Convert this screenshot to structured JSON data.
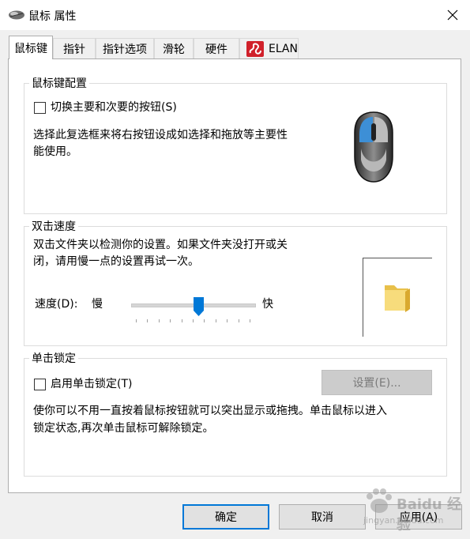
{
  "window": {
    "title": "鼠标 属性",
    "close_label": "✕"
  },
  "tabs": [
    "鼠标键",
    "指针",
    "指针选项",
    "滑轮",
    "硬件",
    "ELAN"
  ],
  "active_tab": "鼠标键",
  "button_config": {
    "group_title": "鼠标键配置",
    "switch_checkbox_label": "切换主要和次要的按钮(S)",
    "switch_checked": false,
    "description_line1": "选择此复选框来将右按钮设成如选择和拖放等主要性",
    "description_line2": "能使用。"
  },
  "double_click": {
    "group_title": "双击速度",
    "description_line1": "双击文件夹以检测你的设置。如果文件夹没打开或关",
    "description_line2": "闭，请用慢一点的设置再试一次。",
    "speed_label": "速度(D):",
    "slow_label": "慢",
    "fast_label": "快",
    "speed_level_fraction": 0.55
  },
  "click_lock": {
    "group_title": "单击锁定",
    "checkbox_label": "启用单击锁定(T)",
    "checked": false,
    "settings_button": "设置(E)...",
    "description_line1": "使你可以不用一直按着鼠标按钮就可以突出显示或拖拽。单击鼠标以进入",
    "description_line2": "锁定状态,再次单击鼠标可解除锁定。"
  },
  "footer": {
    "ok": "确定",
    "cancel": "取消",
    "apply": "应用(A)"
  },
  "watermark": {
    "line1": "Baidu 经验",
    "line2": "jingyan.baidu.com"
  },
  "colors": {
    "accent": "#0078d7",
    "mouse_highlight": "#3d8fd6"
  }
}
